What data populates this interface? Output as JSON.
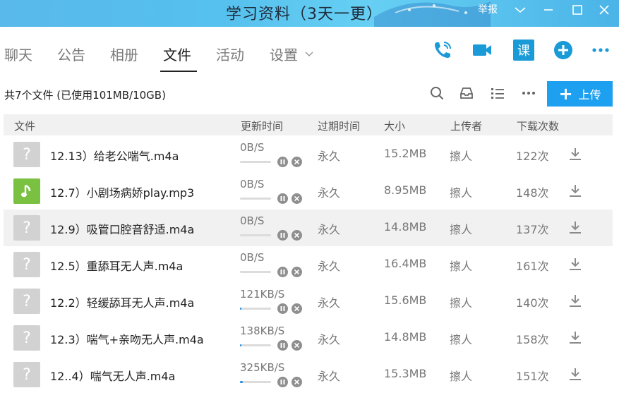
{
  "window": {
    "title": "学习资料（3天一更）",
    "report_label": "举报"
  },
  "tabs": [
    {
      "label": "聊天"
    },
    {
      "label": "公告"
    },
    {
      "label": "相册"
    },
    {
      "label": "文件"
    },
    {
      "label": "活动"
    },
    {
      "label": "设置"
    }
  ],
  "tab_icons": [
    "phone-icon",
    "video-icon",
    "course-icon",
    "add-icon",
    "more-icon"
  ],
  "course_icon_text": "课",
  "toolbar": {
    "file_count": "共7个文件 (已使用101MB/10GB)",
    "upload_label": "上传"
  },
  "table": {
    "headers": [
      "文件",
      "更新时间",
      "过期时间",
      "大小",
      "上传者",
      "下载次数"
    ],
    "rows": [
      {
        "icon": "unknown-file-icon",
        "name": "12.13）给老公喘气.m4a",
        "speed": "0B/S",
        "progress": 0,
        "expire": "永久",
        "size": "15.2MB",
        "uploader": "擦人",
        "downloads": "122次"
      },
      {
        "icon": "music-file-icon",
        "name": "12.7）小剧场病娇play.mp3",
        "speed": "0B/S",
        "progress": 0,
        "expire": "永久",
        "size": "8.95MB",
        "uploader": "擦人",
        "downloads": "148次"
      },
      {
        "icon": "unknown-file-icon",
        "name": "12.9）吸管口腔音舒适.m4a",
        "speed": "0B/S",
        "progress": 0,
        "expire": "永久",
        "size": "14.8MB",
        "uploader": "擦人",
        "downloads": "137次"
      },
      {
        "icon": "unknown-file-icon",
        "name": "12.5）重舔耳无人声.m4a",
        "speed": "0B/S",
        "progress": 0,
        "expire": "永久",
        "size": "16.4MB",
        "uploader": "擦人",
        "downloads": "161次"
      },
      {
        "icon": "unknown-file-icon",
        "name": "12.2）轻缓舔耳无人声.m4a",
        "speed": "121KB/S",
        "progress": 0.04,
        "expire": "永久",
        "size": "15.6MB",
        "uploader": "擦人",
        "downloads": "140次"
      },
      {
        "icon": "unknown-file-icon",
        "name": "12.3）喘气+亲吻无人声.m4a",
        "speed": "138KB/S",
        "progress": 0.05,
        "expire": "永久",
        "size": "14.8MB",
        "uploader": "擦人",
        "downloads": "158次"
      },
      {
        "icon": "unknown-file-icon",
        "name": "12..4）喘气无人声.m4a",
        "speed": "325KB/S",
        "progress": 0.08,
        "expire": "永久",
        "size": "15.3MB",
        "uploader": "擦人",
        "downloads": "151次"
      }
    ]
  },
  "colors": {
    "accent": "#1ea0f0",
    "tab_icon": "#1a9ad6",
    "music_icon": "#7ac142",
    "unknown_icon": "#d2d2d2",
    "highlight_row": "#f1f1f1"
  }
}
